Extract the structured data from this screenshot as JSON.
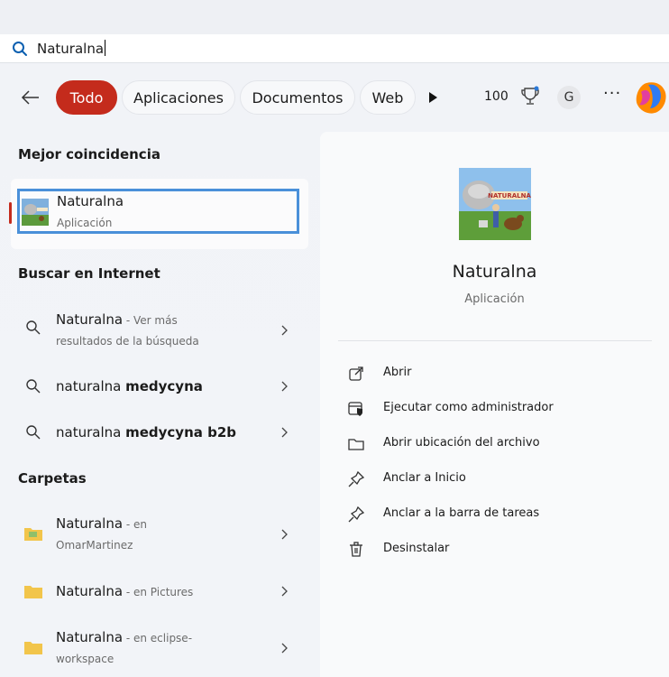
{
  "search": {
    "query": "Naturalna"
  },
  "filters": {
    "tabs": [
      {
        "label": "Todo",
        "active": true
      },
      {
        "label": "Aplicaciones",
        "active": false
      },
      {
        "label": "Documentos",
        "active": false
      },
      {
        "label": "Web",
        "active": false
      }
    ],
    "points": "100",
    "avatar_letter": "G",
    "more_label": "···"
  },
  "sections": {
    "best_match": "Mejor coincidencia",
    "web": "Buscar en Internet",
    "folders": "Carpetas"
  },
  "best_match": {
    "name": "Naturalna",
    "type": "Aplicación"
  },
  "web_results": [
    {
      "main": "Naturalna",
      "suffix": " - Ver más",
      "line2": "resultados de la búsqueda"
    },
    {
      "main": "naturalna ",
      "bold": "medycyna"
    },
    {
      "main": "naturalna ",
      "bold": "medycyna b2b"
    }
  ],
  "folder_results": [
    {
      "main": "Naturalna",
      "suffix": " - en",
      "line2": "OmarMartinez"
    },
    {
      "main": "Naturalna",
      "suffix": " - en Pictures"
    },
    {
      "main": "Naturalna",
      "suffix": " - en eclipse-",
      "line2": "workspace"
    }
  ],
  "detail": {
    "title": "Naturalna",
    "type": "Aplicación",
    "actions": [
      {
        "label": "Abrir",
        "icon": "open-external-icon"
      },
      {
        "label": "Ejecutar como administrador",
        "icon": "admin-shield-icon"
      },
      {
        "label": "Abrir ubicación del archivo",
        "icon": "folder-icon"
      },
      {
        "label": "Anclar a Inicio",
        "icon": "pin-icon"
      },
      {
        "label": "Anclar a la barra de tareas",
        "icon": "pin-icon"
      },
      {
        "label": "Desinstalar",
        "icon": "trash-icon"
      }
    ]
  },
  "colors": {
    "accent": "#c42b1c",
    "focus": "#4a90d9"
  }
}
